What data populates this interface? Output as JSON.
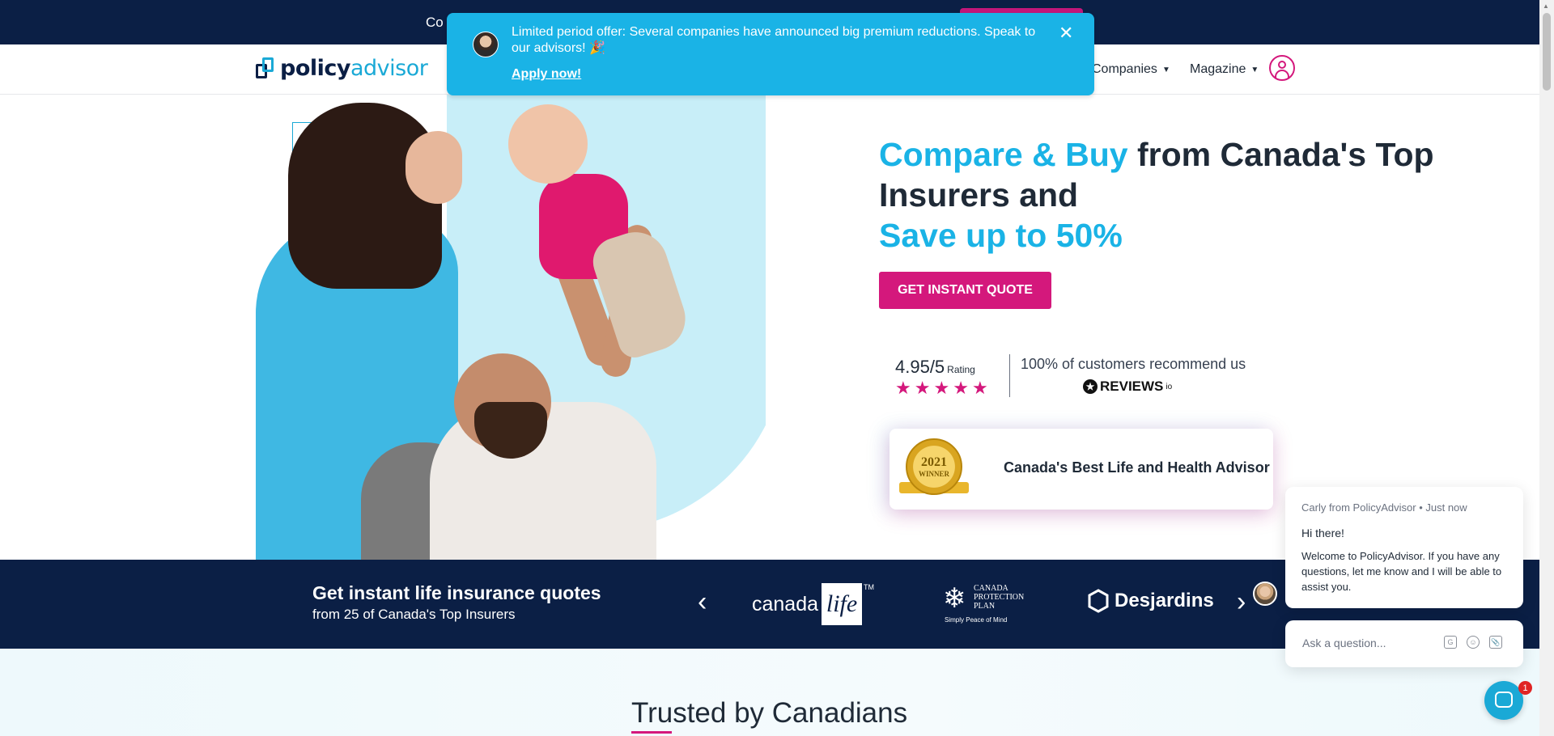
{
  "topbar": {
    "text": "Co",
    "button_label": ""
  },
  "header": {
    "logo": {
      "part1": "policy",
      "part2": "advisor"
    },
    "nav": [
      {
        "label": "Companies"
      },
      {
        "label": "Magazine"
      }
    ]
  },
  "notice": {
    "text": "Limited period offer: Several companies have announced big premium reductions. Speak to our advisors! 🎉",
    "link": "Apply now!",
    "close": "✕"
  },
  "hero": {
    "headline_a": "Compare & Buy",
    "headline_b": " from Canada's Top Insurers and ",
    "headline_c": "Save up to 50%",
    "cta": "GET INSTANT QUOTE",
    "rating": {
      "value": "4.95/5",
      "label": "Rating",
      "stars": 5
    },
    "recommend": "100% of customers recommend us",
    "reviews_brand": "REVIEWS",
    "reviews_suffix": "io",
    "award": {
      "year": "2021",
      "seal_text": "WINNER",
      "title": "Canada's Best Life and Health Advisor"
    }
  },
  "strip": {
    "title": "Get instant life insurance quotes",
    "subtitle": "from 25 of Canada's Top Insurers",
    "insurers": {
      "canada_life": {
        "a": "canada",
        "b": "life",
        "tm": "TM"
      },
      "ccp": {
        "name": "CANADA PROTECTION PLAN",
        "tag": "Simply Peace of Mind"
      },
      "desjardins": "Desjardins"
    }
  },
  "trusted": {
    "title": "Trusted by Canadians"
  },
  "chat": {
    "from": "Carly from PolicyAdvisor • Just now",
    "greeting": "Hi there!",
    "message": "Welcome to PolicyAdvisor. If you have any questions, let me know and I will be able to assist you.",
    "placeholder": "Ask a question...",
    "badge_count": "1"
  },
  "colors": {
    "navy": "#0b1f45",
    "accent_blue": "#1ab3e6",
    "accent_pink": "#d4187c",
    "notice_bg": "#1ab3e6"
  }
}
